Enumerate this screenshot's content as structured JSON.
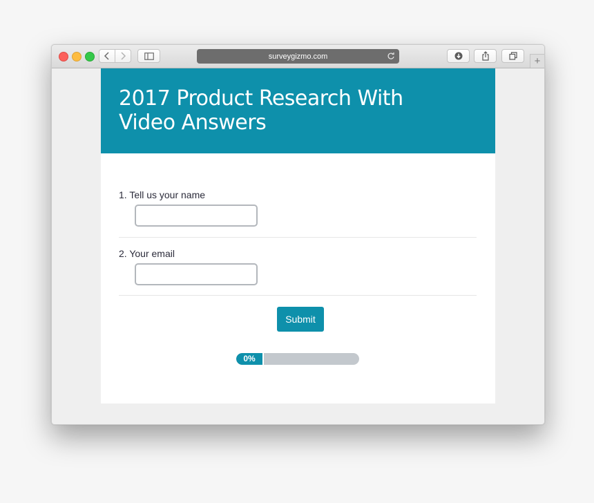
{
  "browser": {
    "url": "surveygizmo.com",
    "new_tab_label": "+",
    "icons": {
      "back": "chevron-left-icon",
      "forward": "chevron-right-icon",
      "sidebar": "sidebar-icon",
      "reload": "reload-icon",
      "download": "download-icon",
      "share": "share-icon",
      "tabs": "tabs-icon"
    }
  },
  "survey": {
    "title": "2017 Product Research With Video Answers",
    "questions": [
      {
        "label": "1. Tell us your name",
        "value": ""
      },
      {
        "label": "2. Your email",
        "value": ""
      }
    ],
    "submit_label": "Submit",
    "progress_label": "0%",
    "progress_percent": 0
  },
  "colors": {
    "accent": "#0e90ab",
    "progress_track": "#c3c8cd",
    "page_background": "#efefef"
  }
}
